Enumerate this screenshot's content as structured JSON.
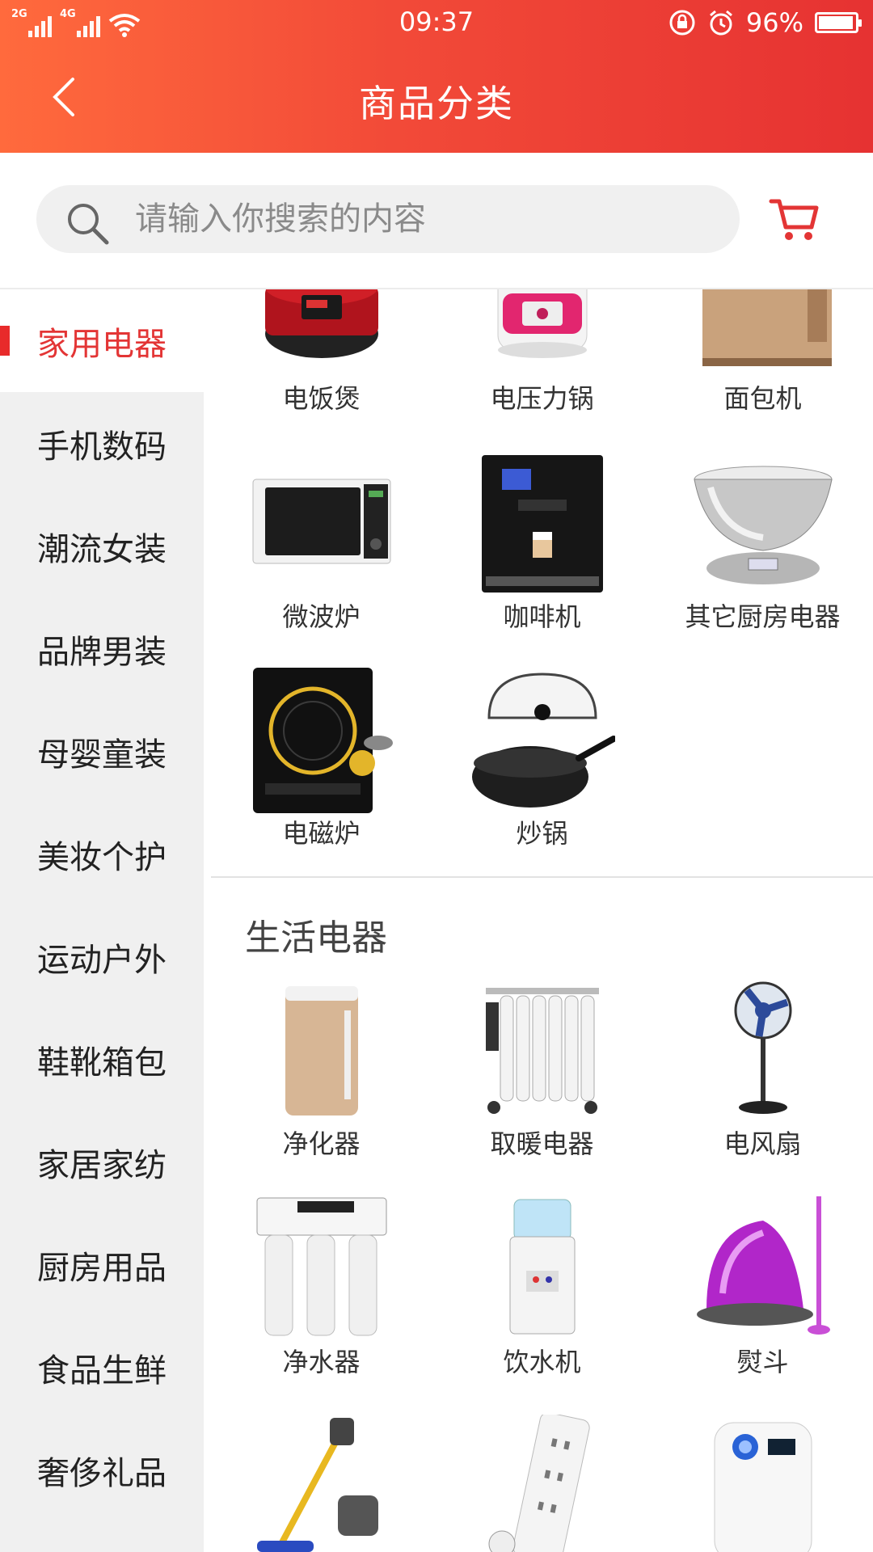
{
  "status_bar": {
    "sim1_tag": "2G",
    "sim2_tag": "4G",
    "time": "09:37",
    "battery_text": "96%",
    "battery_level": 0.96
  },
  "header": {
    "title": "商品分类",
    "color_start": "#ff6a3d",
    "color_end": "#e63232"
  },
  "search": {
    "placeholder": "请输入你搜索的内容",
    "value": ""
  },
  "sidebar": {
    "active_index": 0,
    "items": [
      {
        "label": "家用电器"
      },
      {
        "label": "手机数码"
      },
      {
        "label": "潮流女装"
      },
      {
        "label": "品牌男装"
      },
      {
        "label": "母婴童装"
      },
      {
        "label": "美妆个护"
      },
      {
        "label": "运动户外"
      },
      {
        "label": "鞋靴箱包"
      },
      {
        "label": "家居家纺"
      },
      {
        "label": "厨房用品"
      },
      {
        "label": "食品生鲜"
      },
      {
        "label": "奢侈礼品"
      }
    ]
  },
  "content": {
    "kitchen": {
      "items": [
        {
          "label": "电饭煲",
          "icon": "rice-cooker-icon"
        },
        {
          "label": "电压力锅",
          "icon": "pressure-cooker-icon"
        },
        {
          "label": "面包机",
          "icon": "bread-maker-icon"
        },
        {
          "label": "微波炉",
          "icon": "microwave-icon"
        },
        {
          "label": "咖啡机",
          "icon": "coffee-machine-icon"
        },
        {
          "label": "其它厨房电器",
          "icon": "kitchen-scale-icon"
        },
        {
          "label": "电磁炉",
          "icon": "induction-cooker-icon"
        },
        {
          "label": "炒锅",
          "icon": "wok-icon"
        }
      ]
    },
    "living": {
      "title": "生活电器",
      "items": [
        {
          "label": "净化器",
          "icon": "air-purifier-icon"
        },
        {
          "label": "取暖电器",
          "icon": "heater-icon"
        },
        {
          "label": "电风扇",
          "icon": "fan-icon"
        },
        {
          "label": "净水器",
          "icon": "water-purifier-icon"
        },
        {
          "label": "饮水机",
          "icon": "water-dispenser-icon"
        },
        {
          "label": "熨斗",
          "icon": "garment-steamer-icon"
        },
        {
          "label": "",
          "icon": "vacuum-cleaner-icon"
        },
        {
          "label": "",
          "icon": "power-strip-icon"
        },
        {
          "label": "",
          "icon": "humidifier-icon"
        }
      ]
    }
  }
}
